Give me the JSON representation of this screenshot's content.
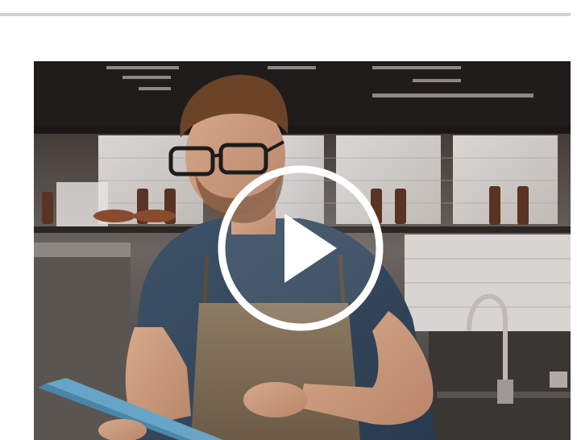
{
  "page": {
    "divider_color": "#d3d3d3"
  },
  "video": {
    "thumbnail_subject": "person-with-tablet-icon",
    "play_icon": "play-icon",
    "overlay_color": "#ffffff"
  }
}
